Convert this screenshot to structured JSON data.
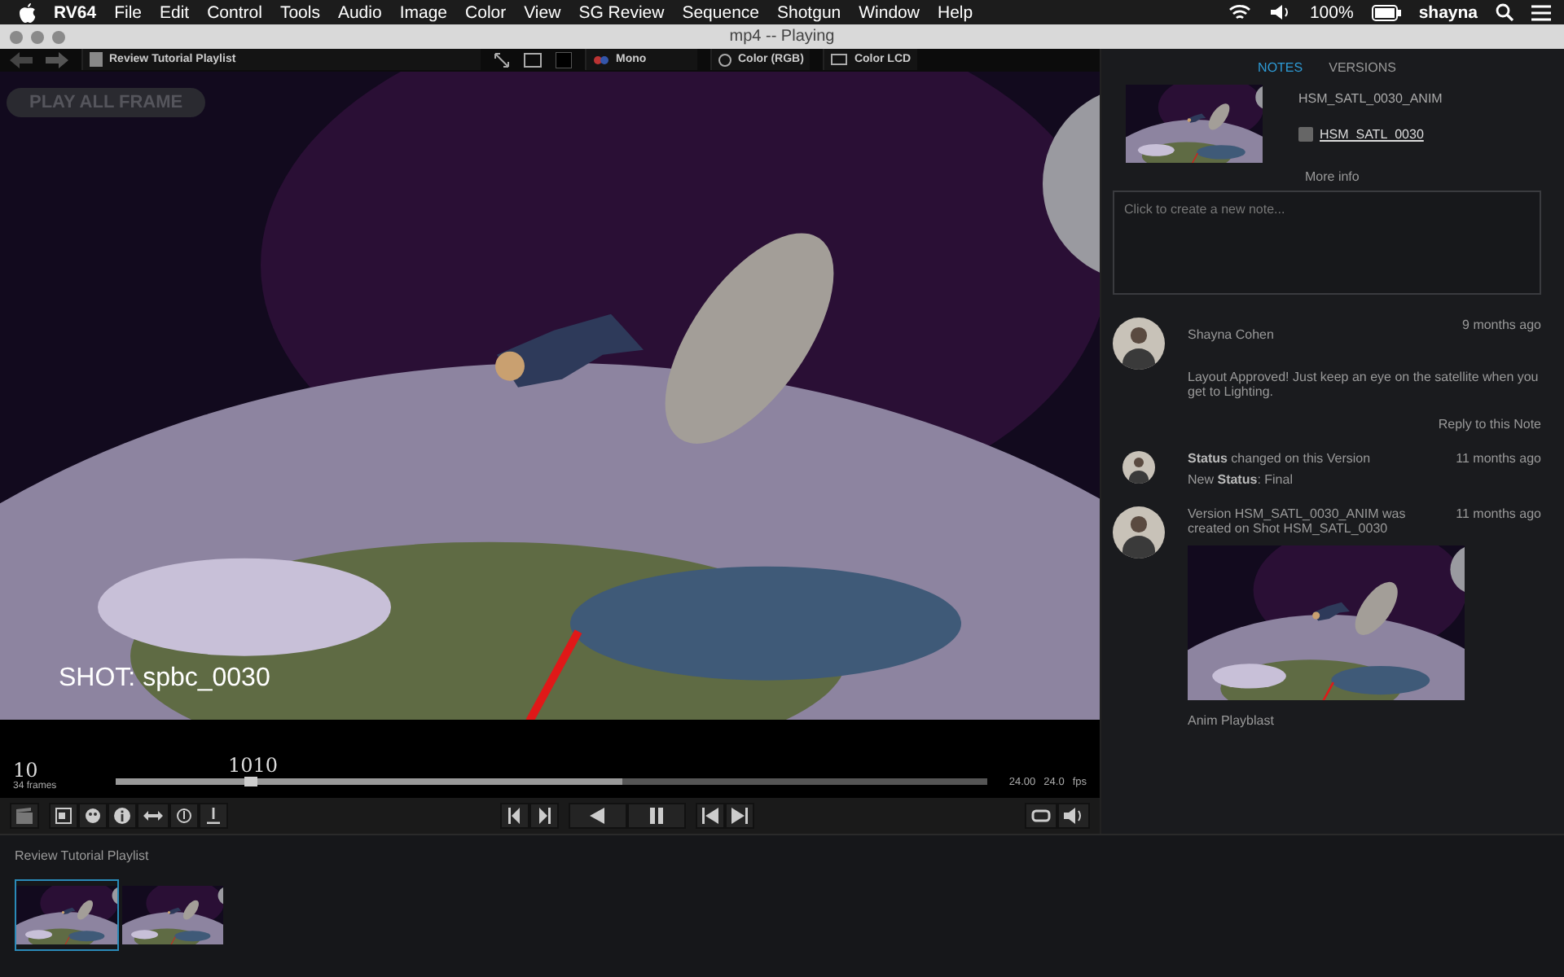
{
  "menu_bar": {
    "app": "RV64",
    "items": [
      "File",
      "Edit",
      "Control",
      "Tools",
      "Audio",
      "Image",
      "Color",
      "View",
      "SG Review",
      "Sequence",
      "Shotgun",
      "Window",
      "Help"
    ],
    "battery": "100%",
    "user": "shayna"
  },
  "window": {
    "title": "mp4 -- Playing"
  },
  "toolbar": {
    "playlist": "Review Tutorial Playlist",
    "channel": "Mono",
    "color_space": "Color (RGB)",
    "display": "Color LCD"
  },
  "viewer": {
    "overlay_button": "PLAY ALL FRAME",
    "shot_label": "SHOT: spbc_0030"
  },
  "timeline": {
    "frame": "10",
    "frame_count": "34 frames",
    "playhead": {
      "label": "1010",
      "level": 0.155
    },
    "level": 0.58,
    "target_fps": "24.00",
    "fps": "24.0",
    "fps_unit": "fps"
  },
  "notes_panel": {
    "tabs": [
      {
        "label": "NOTES",
        "selected": true
      },
      {
        "label": "VERSIONS",
        "selected": false
      }
    ],
    "version": {
      "name": "HSM_SATL_0030_ANIM",
      "shot": "HSM_SATL_0030",
      "more_info": "More info"
    },
    "note_field": {
      "placeholder": "Click to create a new note..."
    },
    "activity": [
      {
        "kind": "note",
        "author": "Shayna Cohen",
        "time": "9 months ago",
        "body": "Layout Approved! Just keep an eye on the satellite when you get to Lighting.",
        "reply": "Reply to this Note"
      },
      {
        "kind": "status",
        "text": "**Status** changed on this Version",
        "time": "11 months ago",
        "detail": "New **Status**: Final"
      },
      {
        "kind": "version",
        "text": "Version HSM_SATL_0030_ANIM was created on Shot HSM_SATL_0030",
        "time": "11 months ago",
        "caption": "Anim Playblast"
      }
    ]
  },
  "playlist_strip": {
    "title": "Review Tutorial Playlist",
    "thumbnails": [
      {
        "selected": true
      },
      {
        "selected": false
      }
    ]
  }
}
